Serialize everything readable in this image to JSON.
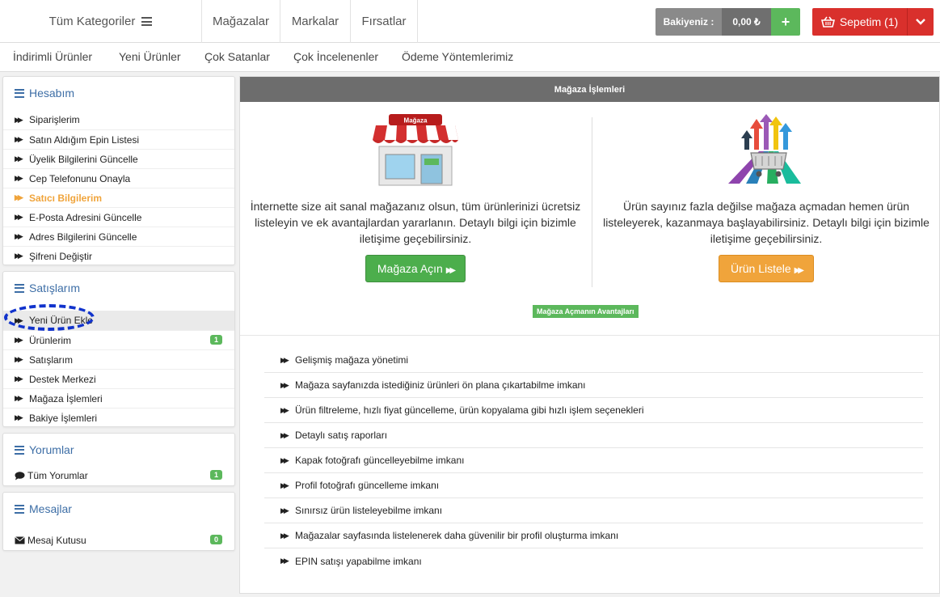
{
  "header": {
    "categories_label": "Tüm Kategoriler",
    "nav": [
      "Mağazalar",
      "Markalar",
      "Fırsatlar"
    ],
    "balance_label": "Bakiyeniz :",
    "balance_value": "0,00 ₺",
    "balance_add": "+",
    "cart_label": "Sepetim (1)"
  },
  "subnav": [
    "İndirimli Ürünler",
    "Yeni Ürünler",
    "Çok Satanlar",
    "Çok İncelenenler",
    "Ödeme Yöntemlerimiz"
  ],
  "sidebar": {
    "account": {
      "title": "Hesabım",
      "items": [
        {
          "label": "Siparişlerim"
        },
        {
          "label": "Satın Aldığım Epin Listesi"
        },
        {
          "label": "Üyelik Bilgilerini Güncelle"
        },
        {
          "label": "Cep Telefonunu Onayla"
        },
        {
          "label": "Satıcı Bilgilerim"
        },
        {
          "label": "E-Posta Adresini Güncelle"
        },
        {
          "label": "Adres Bilgilerini Güncelle"
        },
        {
          "label": "Şifreni Değiştir"
        }
      ]
    },
    "sales": {
      "title": "Satışlarım",
      "items": [
        {
          "label": "Yeni Ürün Ekle"
        },
        {
          "label": "Ürünlerim",
          "badge": "1"
        },
        {
          "label": "Satışlarım"
        },
        {
          "label": "Destek Merkezi"
        },
        {
          "label": "Mağaza İşlemleri"
        },
        {
          "label": "Bakiye İşlemleri"
        }
      ]
    },
    "reviews": {
      "title": "Yorumlar",
      "items": [
        {
          "label": "Tüm Yorumlar",
          "badge": "1"
        }
      ]
    },
    "messages": {
      "title": "Mesajlar",
      "items": [
        {
          "label": "Mesaj Kutusu",
          "badge": "0"
        }
      ]
    }
  },
  "main": {
    "title": "Mağaza İşlemleri",
    "store_sign": "Mağaza",
    "left_text": "İnternette size ait sanal mağazanız olsun, tüm ürünlerinizi ücretsiz listeleyin ve ek avantajlardan yararlanın. Detaylı bilgi için bizimle iletişime geçebilirsiniz.",
    "left_button": "Mağaza Açın",
    "right_text": "Ürün sayınız fazla değilse mağaza açmadan hemen ürün listeleyerek, kazanmaya başlayabilirsiniz. Detaylı bilgi için bizimle iletişime geçebilirsiniz.",
    "right_button": "Ürün Listele",
    "advantages_label": "Mağaza Açmanın Avantajları",
    "advantages": [
      "Gelişmiş mağaza yönetimi",
      "Mağaza sayfanızda istediğiniz ürünleri ön plana çıkartabilme imkanı",
      "Ürün filtreleme, hızlı fiyat güncelleme, ürün kopyalama gibi hızlı işlem seçenekleri",
      "Detaylı satış raporları",
      "Kapak fotoğrafı güncelleyebilme imkanı",
      "Profil fotoğrafı güncelleme imkanı",
      "Sınırsız ürün listeleyebilme imkanı",
      "Mağazalar sayfasında listelenerek daha güvenilir bir profil oluşturma imkanı",
      "EPIN satışı yapabilme imkanı"
    ]
  },
  "colors": {
    "accent_blue": "#3d6ea6",
    "green": "#5cb85c",
    "orange": "#f0a43b",
    "red": "#d9302c"
  }
}
